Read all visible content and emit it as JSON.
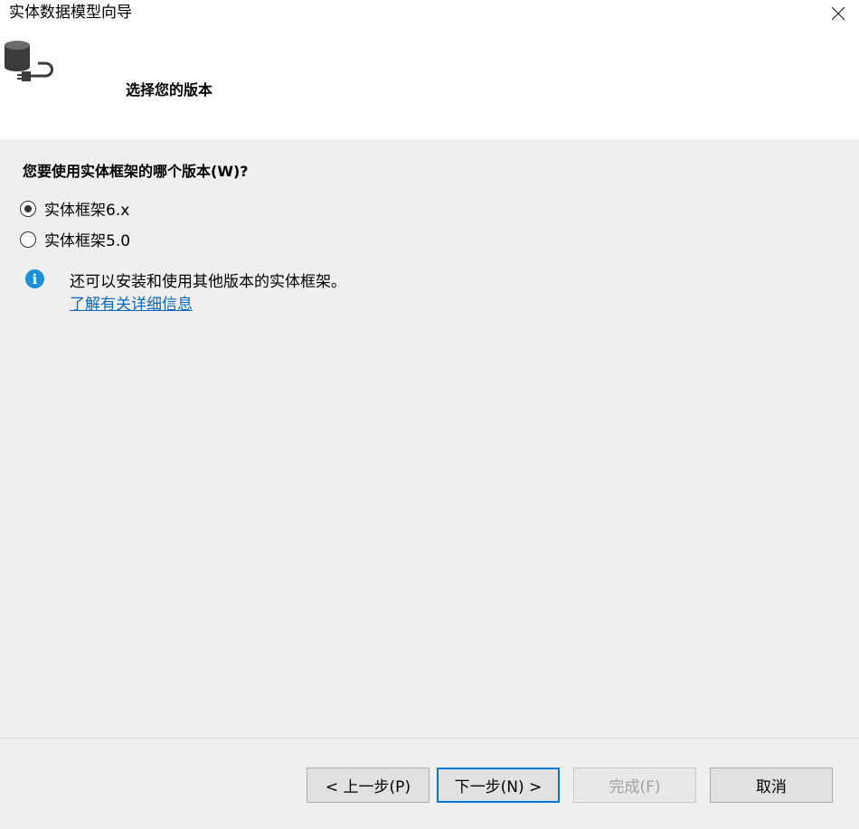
{
  "window": {
    "title": "实体数据模型向导"
  },
  "header": {
    "heading": "选择您的版本"
  },
  "question": "您要使用实体框架的哪个版本(W)?",
  "options": [
    {
      "label": "实体框架6.x",
      "selected": true
    },
    {
      "label": "实体框架5.0",
      "selected": false
    }
  ],
  "info": {
    "text": "还可以安装和使用其他版本的实体框架。",
    "link": "了解有关详细信息"
  },
  "buttons": {
    "back": "< 上一步(P)",
    "next": "下一步(N) >",
    "finish": "完成(F)",
    "cancel": "取消"
  },
  "colors": {
    "accent": "#0078d7",
    "link": "#0a68c2",
    "info": "#1e90d6"
  },
  "icons": {
    "close": "close-icon",
    "wizard": "database-plug-icon",
    "info": "info-icon"
  }
}
